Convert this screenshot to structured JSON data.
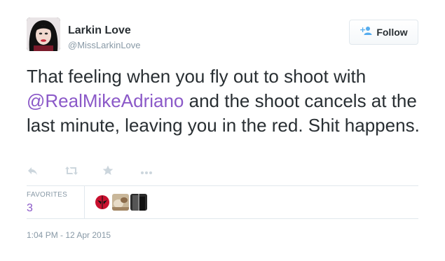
{
  "author": {
    "name": "Larkin Love",
    "handle": "@MissLarkinLove"
  },
  "follow_button": {
    "label": "Follow"
  },
  "tweet": {
    "text_before": "That feeling when you fly out to shoot with ",
    "mention": "@RealMikeAdriano",
    "text_after": " and the shoot cancels at the last minute, leaving you in the red. Shit happens."
  },
  "actions": [
    {
      "name": "reply-icon"
    },
    {
      "name": "retweet-icon"
    },
    {
      "name": "favorite-star-icon"
    },
    {
      "name": "more-icon"
    }
  ],
  "stats": {
    "favorites_label": "FAVORITES",
    "favorites_count": "3"
  },
  "timestamp": "1:04 PM - 12 Apr 2015",
  "colors": {
    "link": "#8b59c8",
    "muted": "#8899a6",
    "text": "#292f33",
    "border": "#e1e8ed"
  }
}
